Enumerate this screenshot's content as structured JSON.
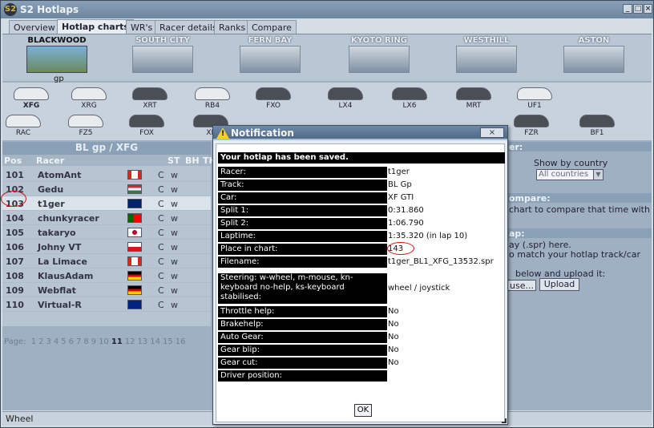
{
  "window": {
    "title": "S2 Hotlaps",
    "logo": "S2"
  },
  "tabs": [
    "Overview",
    "Hotlap charts",
    "WR's",
    "Racer details",
    "Ranks",
    "Compare"
  ],
  "tracks": [
    "BLACKWOOD",
    "SOUTH CITY",
    "FERN BAY",
    "KYOTO RING",
    "WESTHILL",
    "ASTON"
  ],
  "track_sub": "gp",
  "cars": [
    "XFG",
    "XRG",
    "XRT",
    "RB4",
    "FXO",
    "LX4",
    "LX6",
    "MRT",
    "UF1",
    "RAC",
    "FZ5",
    "FOX",
    "XF",
    "FZR",
    "BF1"
  ],
  "chart": {
    "title": "BL gp / XFG",
    "headers": [
      "Pos",
      "Racer",
      "ST",
      "BH",
      "TH"
    ],
    "rows": [
      {
        "pos": "101",
        "racer": "AtomAnt",
        "st": "C",
        "bh": "w",
        "flag": "Canada"
      },
      {
        "pos": "102",
        "racer": "Gedu",
        "st": "C",
        "bh": "w",
        "flag": "Hungary"
      },
      {
        "pos": "103",
        "racer": "t1ger",
        "st": "C",
        "bh": "w",
        "flag": "UK"
      },
      {
        "pos": "104",
        "racer": "chunkyracer",
        "st": "C",
        "bh": "w",
        "flag": "Portugal"
      },
      {
        "pos": "105",
        "racer": "takaryo",
        "st": "C",
        "bh": "w",
        "flag": "Japan"
      },
      {
        "pos": "106",
        "racer": "Johny VT",
        "st": "C",
        "bh": "w",
        "flag": "Czech"
      },
      {
        "pos": "107",
        "racer": "La Limace",
        "st": "C",
        "bh": "w",
        "flag": "Canada"
      },
      {
        "pos": "108",
        "racer": "KlausAdam",
        "st": "C",
        "bh": "w",
        "flag": "Germany"
      },
      {
        "pos": "109",
        "racer": "Webflat",
        "st": "C",
        "bh": "w",
        "flag": "Germany"
      },
      {
        "pos": "110",
        "racer": "Virtual-R",
        "st": "C",
        "bh": "w",
        "flag": "Australia"
      }
    ],
    "pager_label": "Page:",
    "pages": [
      "1",
      "2",
      "3",
      "4",
      "5",
      "6",
      "7",
      "8",
      "9",
      "10",
      "11",
      "12",
      "13",
      "14",
      "15",
      "16"
    ],
    "current_page": "11"
  },
  "right_panel": {
    "filter_bar": "er:",
    "show_by_country": "Show by country",
    "country_select": "All countries",
    "compare_bar": "ompare:",
    "compare_text": "chart to compare that time with",
    "upload_bar": "ap:",
    "upload_line1": "ay (.spr) here.",
    "upload_line2": "o match your hotlap track/car",
    "upload_line3": "below and upload it:",
    "browse_label": "use...",
    "upload_label": "Upload"
  },
  "status": "Wheel",
  "dialog": {
    "title": "Notification",
    "close": "×",
    "heading": "Your hotlap has been saved.",
    "fields": [
      {
        "label": "Racer:",
        "value": "t1ger"
      },
      {
        "label": "Track:",
        "value": "BL Gp"
      },
      {
        "label": "Car:",
        "value": "XF GTI"
      },
      {
        "label": "Split 1:",
        "value": "0:31.860"
      },
      {
        "label": "Split 2:",
        "value": "1:06.790"
      },
      {
        "label": "Laptime:",
        "value": "1:35.320 (in lap 10)"
      },
      {
        "label": "Place in chart:",
        "value": "143"
      },
      {
        "label": "Filename:",
        "value": "t1ger_BL1_XFG_13532.spr"
      }
    ],
    "steering_label": "Steering: w-wheel, m-mouse, kn-keyboard no-help, ks-keyboard stabilised:",
    "steering_value": "wheel / joystick",
    "options": [
      {
        "label": "Throttle help:",
        "value": "No"
      },
      {
        "label": "Brakehelp:",
        "value": "No"
      },
      {
        "label": "Auto Gear:",
        "value": "No"
      },
      {
        "label": "Gear blip:",
        "value": "No"
      },
      {
        "label": "Gear cut:",
        "value": "No"
      },
      {
        "label": "Driver position:",
        "value": ""
      }
    ],
    "ok": "OK"
  },
  "colors": {
    "flag_canada": "#d52b1e",
    "flag_hungary": "#477050",
    "flag_uk": "#012169",
    "flag_portugal": "#006600",
    "flag_japan": "#bc002d",
    "flag_czech": "#11457e",
    "flag_germany": "#000000",
    "flag_australia": "#00247d",
    "annotation_red": "#d01010"
  }
}
